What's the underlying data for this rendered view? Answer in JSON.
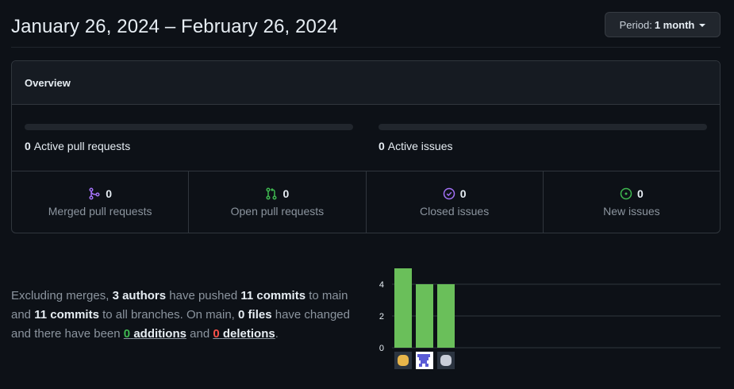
{
  "header": {
    "date_range": "January 26, 2024 – February 26, 2024",
    "period_prefix": "Period:",
    "period_value": "1 month"
  },
  "overview": {
    "title": "Overview",
    "active_prs": {
      "count": "0",
      "label": "Active pull requests"
    },
    "active_issues": {
      "count": "0",
      "label": "Active issues"
    },
    "cells": [
      {
        "count": "0",
        "label": "Merged pull requests",
        "icon": "git-merge-icon",
        "color": "#a371f7"
      },
      {
        "count": "0",
        "label": "Open pull requests",
        "icon": "git-pull-request-icon",
        "color": "#3fb950"
      },
      {
        "count": "0",
        "label": "Closed issues",
        "icon": "issue-closed-icon",
        "color": "#a371f7"
      },
      {
        "count": "0",
        "label": "New issues",
        "icon": "issue-opened-icon",
        "color": "#3fb950"
      }
    ]
  },
  "summary": {
    "p1": "Excluding merges,",
    "authors": "3 authors",
    "p2": "have pushed",
    "commits_main": "11 commits",
    "p3": "to main and",
    "commits_all": "11 commits",
    "p4": "to all branches. On main,",
    "files": "0 files",
    "p5": "have changed and there have been",
    "additions_num": "0",
    "additions_word": "additions",
    "and": "and",
    "deletions_num": "0",
    "deletions_word": "deletions",
    "end": "."
  },
  "chart_data": {
    "type": "bar",
    "categories": [
      "author-1",
      "author-2",
      "author-3"
    ],
    "values": [
      5,
      4,
      4
    ],
    "yticks": [
      0,
      2,
      4
    ],
    "ylim": [
      0,
      5
    ],
    "bar_color": "#6abf5a",
    "avatar_colors": [
      "#e7b54a",
      "#5b5bd6",
      "#c8cdd8"
    ]
  }
}
